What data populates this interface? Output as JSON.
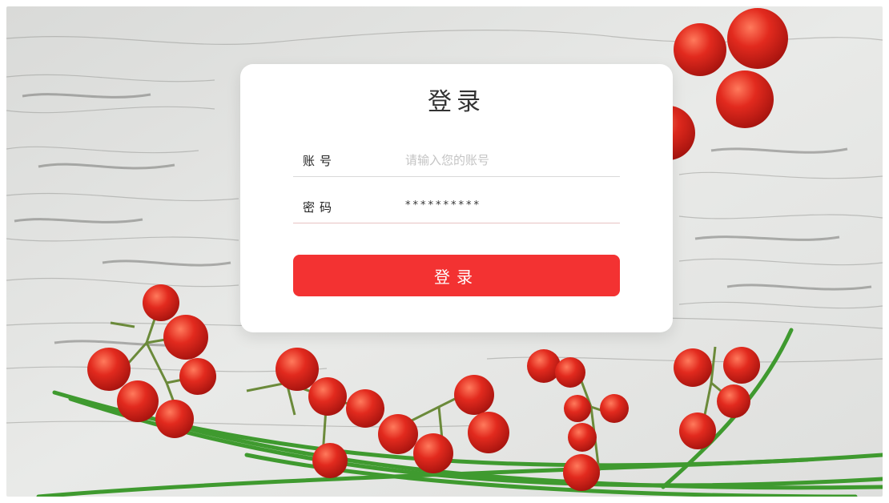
{
  "login": {
    "title": "登录",
    "account_label": "账号",
    "account_placeholder": "请输入您的账号",
    "account_value": "",
    "password_label": "密码",
    "password_masked": "**********",
    "submit_label": "登录"
  },
  "theme": {
    "accent": "#f33232",
    "background": "#e4e5e3",
    "tomato": "#d8231b"
  }
}
